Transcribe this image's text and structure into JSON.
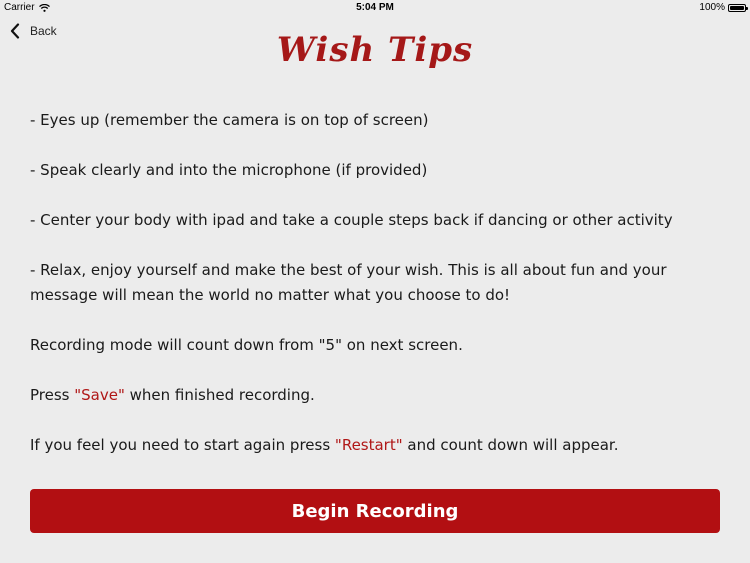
{
  "status_bar": {
    "carrier": "Carrier",
    "time": "5:04 PM",
    "battery": "100%"
  },
  "nav": {
    "back_label": "Back"
  },
  "title": "Wish Tips",
  "tips": [
    "- Eyes up (remember the camera is on top of screen)",
    "- Speak clearly and into the microphone (if provided)",
    "- Center your body with ipad and take a couple steps back if dancing or other activity",
    "- Relax, enjoy yourself and make the best of your wish.  This is all about fun and your message will mean the world no matter what you choose to do!",
    "Recording mode will count down from \"5\" on next screen."
  ],
  "save_note": {
    "prefix": "Press ",
    "keyword": "\"Save\"",
    "suffix": " when finished recording."
  },
  "restart_note": {
    "prefix": "If you feel you need to start again press ",
    "keyword": "\"Restart\"",
    "suffix": " and count down will appear."
  },
  "primary_button": {
    "label": "Begin Recording"
  },
  "colors": {
    "accent": "#a51818",
    "button_bg": "#b20f12",
    "background": "#ececec"
  },
  "icons": {
    "wifi": "wifi-icon",
    "battery": "battery-icon",
    "back": "chevron-left-icon"
  }
}
